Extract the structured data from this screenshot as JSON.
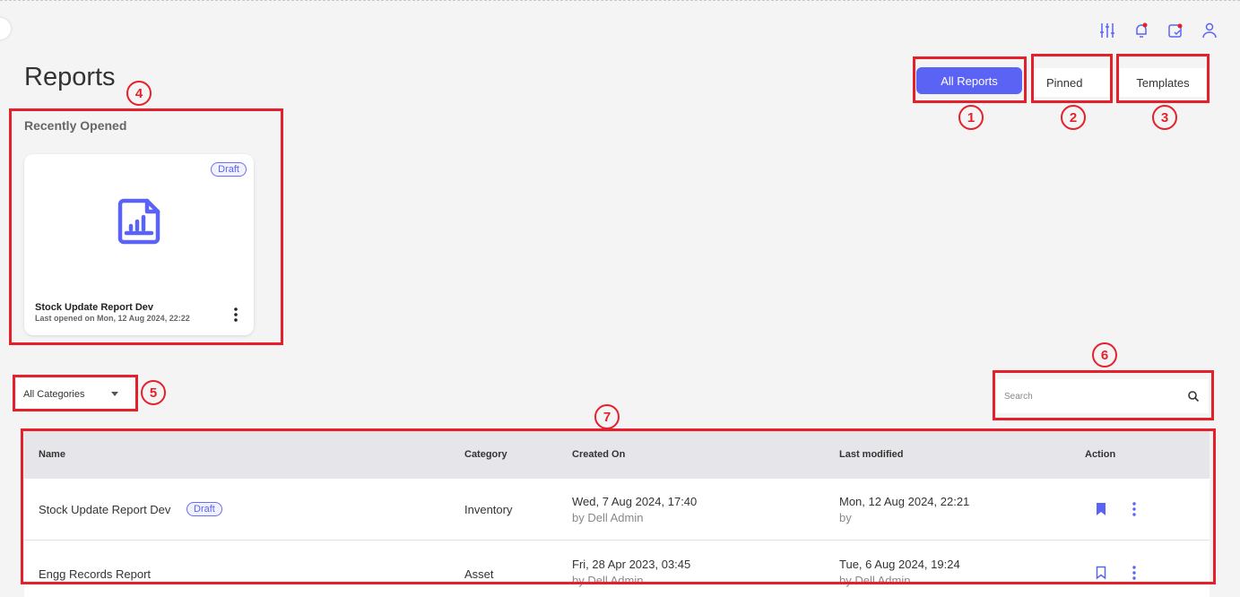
{
  "page": {
    "title": "Reports"
  },
  "header_icons": [
    "filter-sliders-icon",
    "notification-bell-icon",
    "calendar-check-icon",
    "user-icon"
  ],
  "tabs": {
    "all": "All Reports",
    "pinned": "Pinned",
    "templates": "Templates",
    "active": "all"
  },
  "recent": {
    "title": "Recently Opened",
    "card": {
      "badge": "Draft",
      "name": "Stock Update Report Dev",
      "subtitle": "Last opened on Mon, 12 Aug 2024, 22:22",
      "icon": "report-chart-icon"
    }
  },
  "filters": {
    "category": "All Categories",
    "search_placeholder": "Search"
  },
  "table": {
    "columns": [
      "Name",
      "Category",
      "Created On",
      "Last modified",
      "Action"
    ],
    "rows": [
      {
        "name": "Stock Update Report Dev",
        "badge": "Draft",
        "category": "Inventory",
        "created": "Wed, 7 Aug 2024, 17:40",
        "created_by": "by Dell Admin",
        "modified": "Mon, 12 Aug 2024, 22:21",
        "modified_by": "by",
        "pinned": true
      },
      {
        "name": "Engg Records Report",
        "badge": "",
        "category": "Asset",
        "created": "Fri, 28 Apr 2023, 03:45",
        "created_by": "by Dell Admin",
        "modified": "Tue, 6 Aug 2024, 19:24",
        "modified_by": "by Dell Admin",
        "pinned": false
      }
    ]
  },
  "annotations": [
    "1",
    "2",
    "3",
    "4",
    "5",
    "6",
    "7"
  ],
  "colors": {
    "accent": "#5b63f5",
    "annotation": "#e5202a"
  }
}
